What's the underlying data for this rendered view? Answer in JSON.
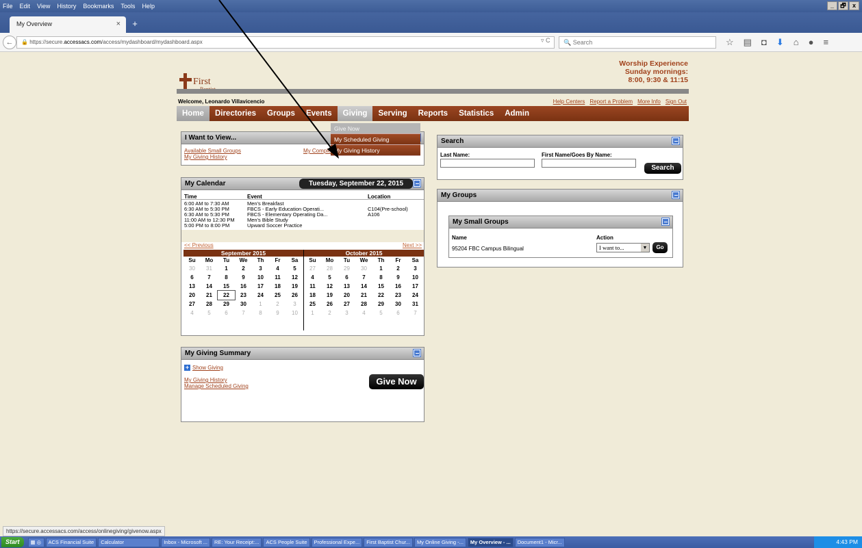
{
  "browser": {
    "menu": [
      "File",
      "Edit",
      "View",
      "History",
      "Bookmarks",
      "Tools",
      "Help"
    ],
    "window_buttons": [
      "_",
      "🗗",
      "x"
    ],
    "tab_title": "My Overview",
    "tab_close": "×",
    "new_tab": "+",
    "url_prefix": "https://secure.",
    "url_host": "accessacs.com",
    "url_path": "/access/mydashboard/mydashboard.aspx",
    "search_placeholder": "Search",
    "status_url": "https://secure.accessacs.com/access/onlinegiving/givenow.aspx"
  },
  "site": {
    "logo_line1": "First",
    "logo_line2": "Baptist",
    "worship_title": "Worship Experience",
    "worship_sub": "Sunday mornings:",
    "worship_times": "8:00, 9:30 & 11:15",
    "welcome": "Welcome, Leonardo Villavicencio",
    "top_links": [
      "Help Centers",
      "Report a Problem",
      "More Info",
      "Sign Out"
    ],
    "nav": [
      "Home",
      "Directories",
      "Groups",
      "Events",
      "Giving",
      "Serving",
      "Reports",
      "Statistics",
      "Admin"
    ],
    "giving_menu": [
      "Give Now",
      "My Scheduled Giving",
      "My Giving History"
    ]
  },
  "want": {
    "title": "I Want to View...",
    "links": [
      "Available Small Groups",
      "My Giving History",
      "My Comple"
    ]
  },
  "calendar": {
    "title": "My Calendar",
    "date": "Tuesday, September 22, 2015",
    "headers": [
      "Time",
      "Event",
      "Location"
    ],
    "events": [
      {
        "time": "6:00 AM to 7:30 AM",
        "event": "Men's Breakfast",
        "location": ""
      },
      {
        "time": "6:30 AM to 5:30 PM",
        "event": "FBCS - Early Education Operati...",
        "location": "C104(Pre-school)"
      },
      {
        "time": "6:30 AM to 5:30 PM",
        "event": "FBCS - Elementary Operating Da...",
        "location": "A106"
      },
      {
        "time": "11:00 AM to 12:30 PM",
        "event": "Men's Bible Study",
        "location": ""
      },
      {
        "time": "5:00 PM to 8:00 PM",
        "event": "Upward Soccer Practice",
        "location": ""
      }
    ],
    "prev": "<< Previous",
    "next": "Next >>",
    "days": [
      "Su",
      "Mo",
      "Tu",
      "We",
      "Th",
      "Fr",
      "Sa"
    ],
    "sep_title": "September 2015",
    "oct_title": "October 2015"
  },
  "giving": {
    "title": "My Giving Summary",
    "show": "Show Giving",
    "history": "My Giving History",
    "manage": "Manage Scheduled Giving",
    "give_now": "Give Now"
  },
  "search": {
    "title": "Search",
    "last_label": "Last Name:",
    "first_label": "First Name/Goes By Name:",
    "button": "Search"
  },
  "groups": {
    "title": "My Groups",
    "sub_title": "My Small Groups",
    "col_name": "Name",
    "col_action": "Action",
    "row_name": "95204 FBC Campus Bilingual",
    "select_value": "I want to...",
    "go": "Go"
  },
  "taskbar": {
    "start": "Start",
    "items": [
      "ACS Financial Suite",
      "Calculator",
      "Inbox - Microsoft ...",
      "RE: Your Receipt:...",
      "ACS People Suite",
      "Professional Expe...",
      "First Baptist Chur...",
      "My Online Giving -...",
      "My Overview - ...",
      "Document1 - Micr..."
    ],
    "clock": "4:43 PM"
  }
}
